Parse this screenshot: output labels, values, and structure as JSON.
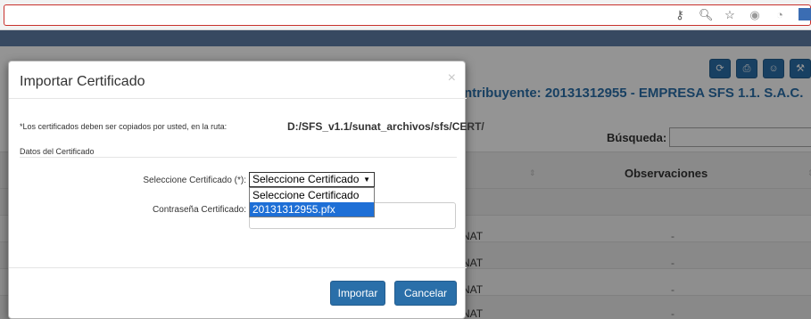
{
  "browser": {
    "icons": [
      "key-icon",
      "zoom-icon",
      "star-icon",
      "extension-icon",
      "extension-icon",
      "extension-icon"
    ]
  },
  "app": {
    "contributor_title": "ntribuyente: 20131312955 - EMPRESA SFS 1.1. S.A.C.",
    "search_label": "Búsqueda:",
    "observations_header": "Observaciones",
    "rows": [
      {
        "origin": "NAT",
        "obs": "-"
      },
      {
        "origin": "NAT",
        "obs": "-"
      },
      {
        "origin": "NAT",
        "obs": "-"
      },
      {
        "origin": "NAT",
        "obs": "-"
      }
    ]
  },
  "modal": {
    "title": "Importar Certificado",
    "close": "×",
    "note": "*Los certificados deben ser copiados por usted, en la ruta:",
    "path": "D:/SFS_v1.1/sunat_archivos/sfs/CERT/",
    "section": "Datos del Certificado",
    "cert_label": "Seleccione Certificado (*):",
    "cert_selected": "Seleccione Certificado",
    "cert_options": [
      "Seleccione Certificado",
      "20131312955.pfx"
    ],
    "cert_highlighted": "20131312955.pfx",
    "password_label": "Contraseña Certificado:",
    "import_button": "Importar",
    "cancel_button": "Cancelar"
  },
  "colors": {
    "primary": "#2a6fa9",
    "dropdown_highlight": "#1e6fd6",
    "address_border": "#c8312d"
  }
}
